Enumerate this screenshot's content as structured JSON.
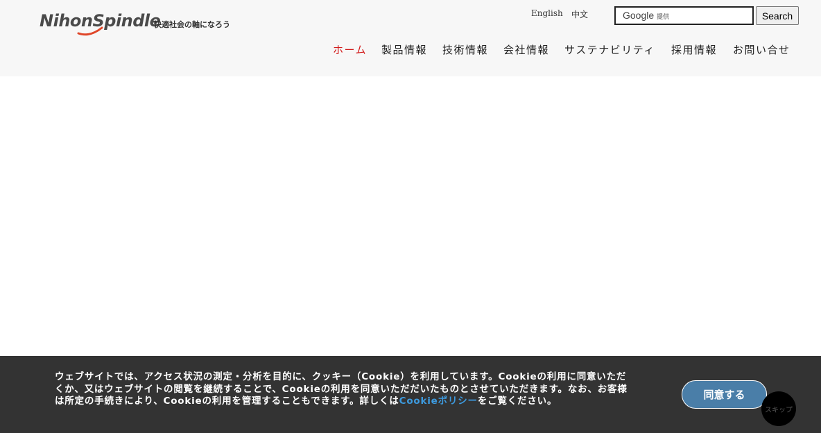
{
  "header": {
    "logo_text": "NihonSpindle",
    "tagline": "快適社会の軸になろう",
    "languages": [
      "English",
      "中文"
    ],
    "search": {
      "brand": "Google",
      "brand_suffix": "提供",
      "button_label": "Search"
    },
    "nav": [
      {
        "label": "ホーム",
        "active": true
      },
      {
        "label": "製品情報",
        "active": false
      },
      {
        "label": "技術情報",
        "active": false
      },
      {
        "label": "会社情報",
        "active": false
      },
      {
        "label": "サステナビリティ",
        "active": false
      },
      {
        "label": "採用情報",
        "active": false
      },
      {
        "label": "お問い合せ",
        "active": false
      }
    ]
  },
  "cookie_banner": {
    "text": "ウェブサイトでは、アクセス状況の測定・分析を目的に、クッキー（Cookie）を利用しています。Cookieの利用に同意いただくか、又はウェブサイトの閲覧を継続することで、Cookieの利用を同意いただだいたものとさせていただきます。なお、お客様は所定の手続きにより、Cookieの利用を管理することもできます。詳しくは",
    "link_text": "Cookieポリシー",
    "text_after": "をご覧ください。",
    "agree_label": "同意する",
    "skip_label": "スキップ"
  },
  "colors": {
    "header_bg": "#f7f7f7",
    "nav_active": "#d21a1a",
    "cookie_bg": "#333333",
    "cookie_link": "#3d9be0",
    "agree_btn": "#4a7ea8"
  }
}
